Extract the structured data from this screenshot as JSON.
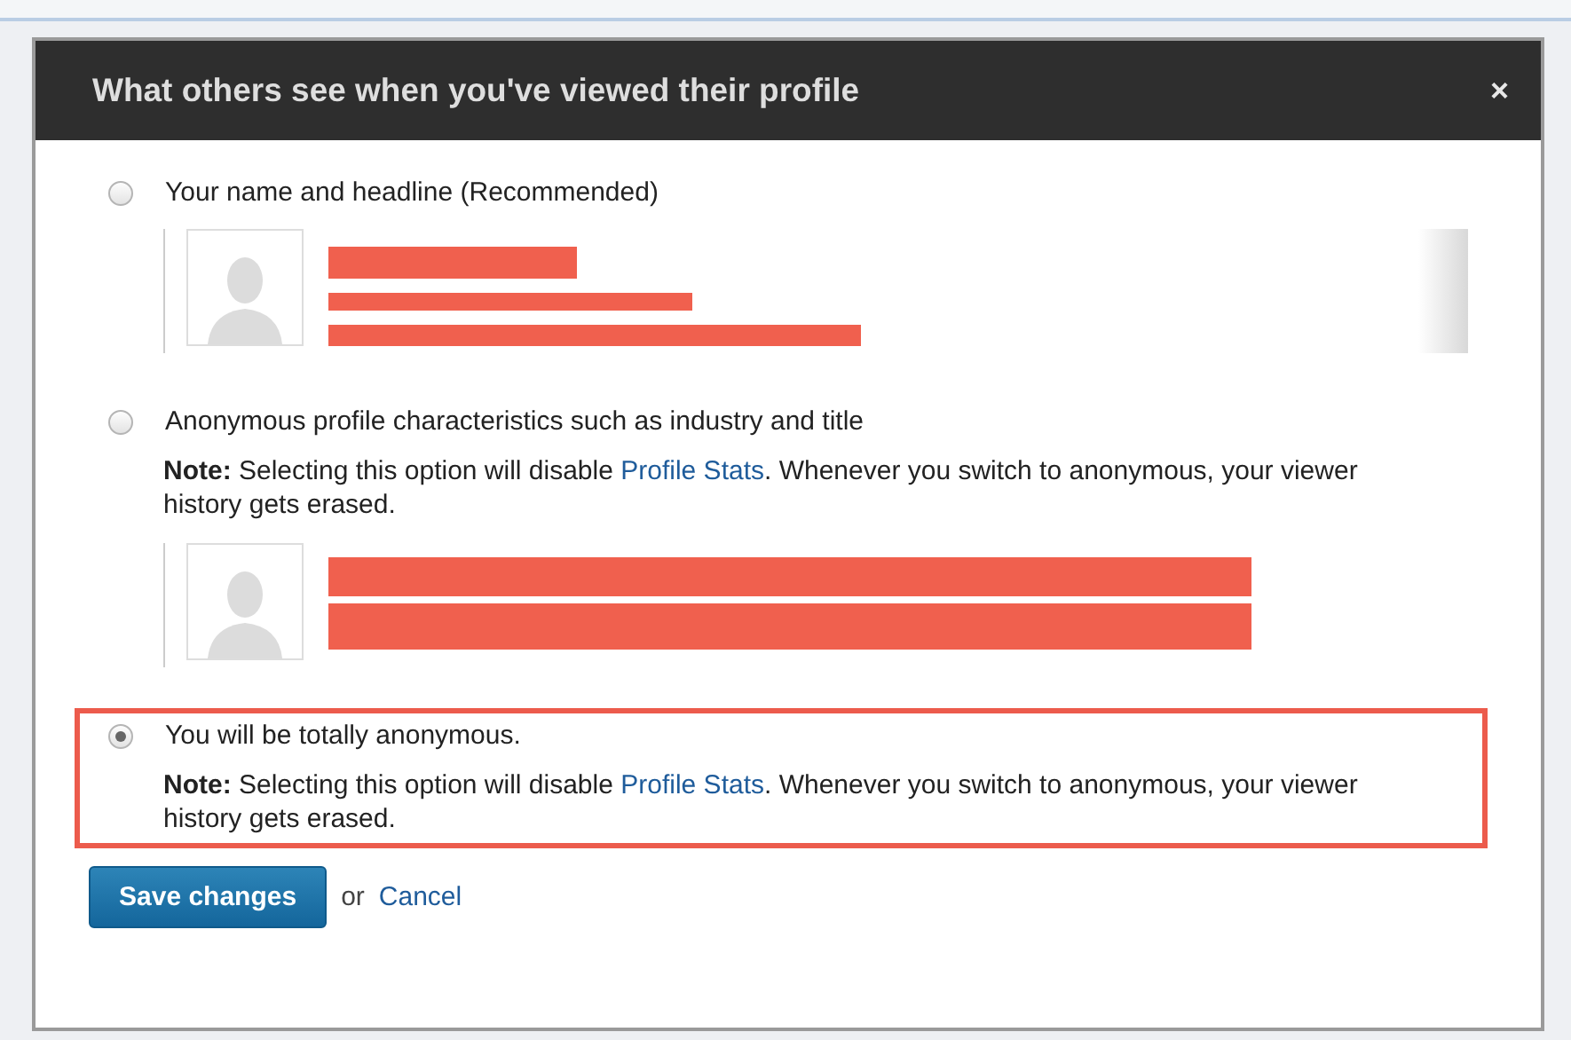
{
  "dialog": {
    "title": "What others see when you've viewed their profile",
    "close": "×"
  },
  "options": [
    {
      "label": "Your name and headline (Recommended)",
      "selected": false,
      "highlighted": false,
      "preview": {
        "kind": "headline"
      }
    },
    {
      "label": "Anonymous profile characteristics such as industry and title",
      "selected": false,
      "highlighted": false,
      "note": {
        "before": "**Note:** Selecting this option will disable ",
        "link": "Profile Stats",
        "after": ". Whenever you switch to anonymous, your viewer history gets erased."
      },
      "preview": {
        "kind": "characteristics"
      }
    },
    {
      "label": "You will be totally anonymous.",
      "selected": true,
      "highlighted": true,
      "note": {
        "before": "**Note:** Selecting this option will disable ",
        "link": "Profile Stats",
        "after": ". Whenever you switch to anonymous, your viewer history gets erased."
      }
    }
  ],
  "actions": {
    "save": "Save changes",
    "or": "or",
    "cancel": "Cancel"
  }
}
